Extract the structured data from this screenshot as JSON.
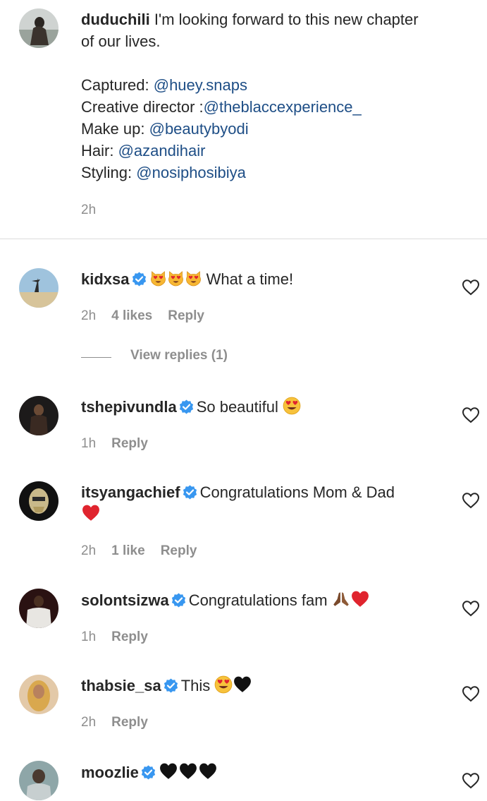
{
  "caption": {
    "username": "duduchili",
    "text_line1": " I'm looking forward to this new chapter",
    "text_line2": "of our lives.",
    "credits": [
      {
        "label": "Captured: ",
        "mention": "@huey.snaps"
      },
      {
        "label": "Creative director :",
        "mention": "@theblaccexperience_"
      },
      {
        "label": "Make up: ",
        "mention": "@beautybyodi"
      },
      {
        "label": "Hair: ",
        "mention": "@azandihair"
      },
      {
        "label": "Styling: ",
        "mention": "@nosiphosibiya"
      }
    ],
    "time": "2h"
  },
  "comments": [
    {
      "username": "kidxsa",
      "text": " What a time!",
      "emojis": [
        "smiling-cat-heart-eyes",
        "smiling-cat-heart-eyes",
        "smiling-cat-heart-eyes"
      ],
      "time": "2h",
      "likes": "4 likes",
      "reply": "Reply"
    },
    {
      "username": "tshepivundla",
      "text": "So beautiful ",
      "emojis": [
        "heart-eyes-face"
      ],
      "time": "1h",
      "likes": "",
      "reply": "Reply"
    },
    {
      "username": "itsyangachief",
      "text": "Congratulations Mom & Dad",
      "emojis": [
        "red-heart"
      ],
      "time": "2h",
      "likes": "1 like",
      "reply": "Reply"
    },
    {
      "username": "solontsizwa",
      "text": "Congratulations fam ",
      "emojis": [
        "folded-hands",
        "red-heart"
      ],
      "time": "1h",
      "likes": "",
      "reply": "Reply"
    },
    {
      "username": "thabsie_sa",
      "text": "This ",
      "emojis": [
        "heart-eyes-face",
        "black-heart"
      ],
      "time": "2h",
      "likes": "",
      "reply": "Reply"
    },
    {
      "username": "moozlie",
      "text": "",
      "emojis": [
        "black-heart",
        "black-heart",
        "black-heart"
      ],
      "time": "",
      "likes": "",
      "reply": ""
    }
  ],
  "view_replies": "View replies (1)",
  "colors": {
    "mention": "#1e4e86",
    "verified": "#3897f0",
    "meta": "#8e8e8e",
    "heart_red": "#e0242e"
  }
}
